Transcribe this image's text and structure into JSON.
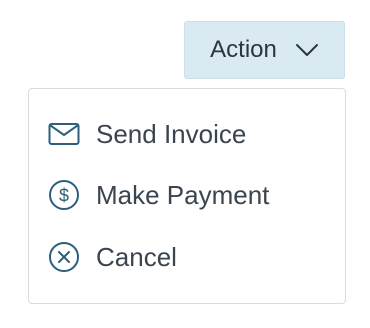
{
  "action_button": {
    "label": "Action",
    "icon": "chevron-down-icon",
    "background": "#d9eaf3"
  },
  "menu": {
    "items": [
      {
        "label": "Send Invoice",
        "icon": "envelope-icon"
      },
      {
        "label": "Make Payment",
        "icon": "dollar-circle-icon"
      },
      {
        "label": "Cancel",
        "icon": "close-circle-icon"
      }
    ],
    "icon_color": "#2d5f7c",
    "text_color": "#3b4550"
  }
}
